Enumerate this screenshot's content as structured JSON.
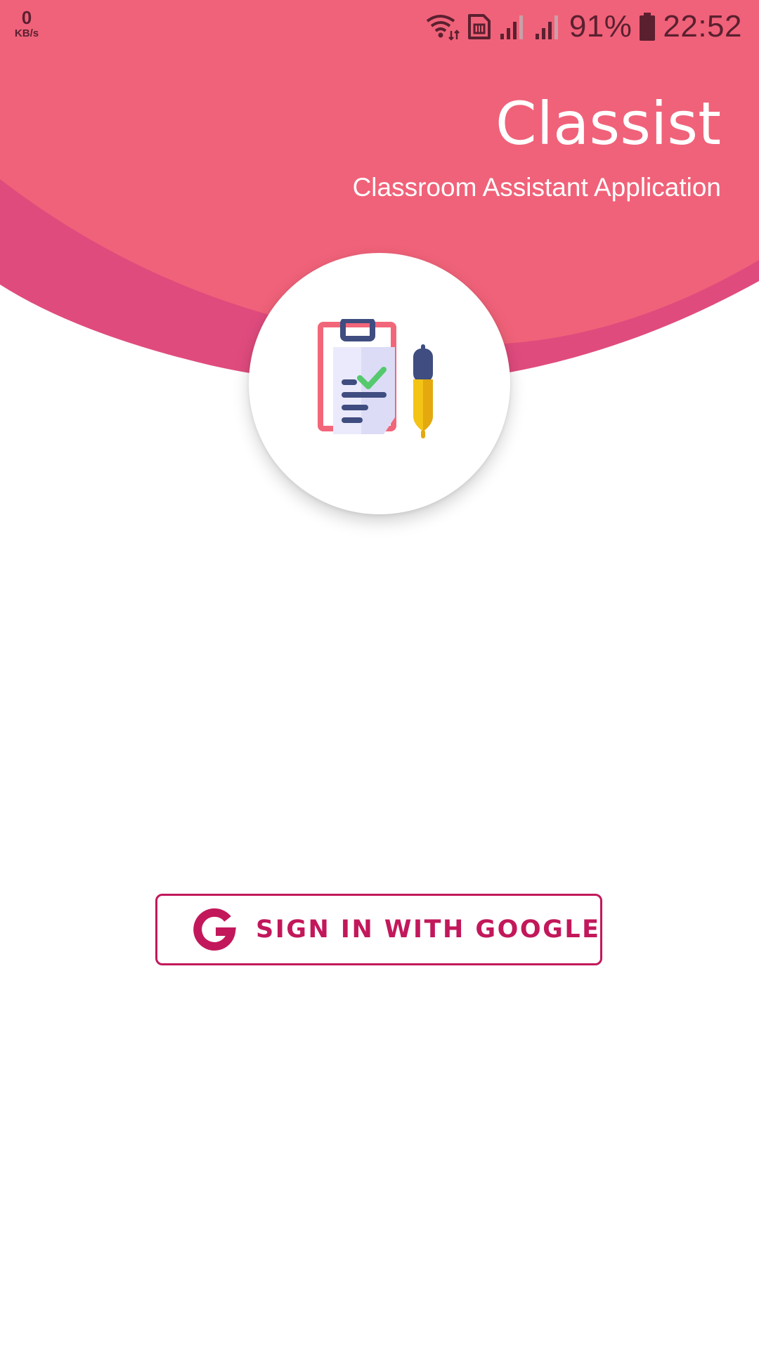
{
  "status_bar": {
    "net_speed_value": "0",
    "net_speed_unit": "KB/s",
    "battery_percent": "91%",
    "time": "22:52",
    "icons": [
      "wifi-icon",
      "sim-card-icon",
      "signal-icon",
      "signal-icon",
      "battery-icon"
    ]
  },
  "header": {
    "title": "Classist",
    "subtitle": "Classroom Assistant Application"
  },
  "logo": {
    "icon": "clipboard-checklist-pen-icon"
  },
  "sign_in": {
    "label": "SIGN IN WITH GOOGLE",
    "icon": "google-icon"
  },
  "colors": {
    "header_primary": "#f06279",
    "header_secondary": "#e04b7e",
    "accent": "#c2185b",
    "background": "#ffffff"
  }
}
